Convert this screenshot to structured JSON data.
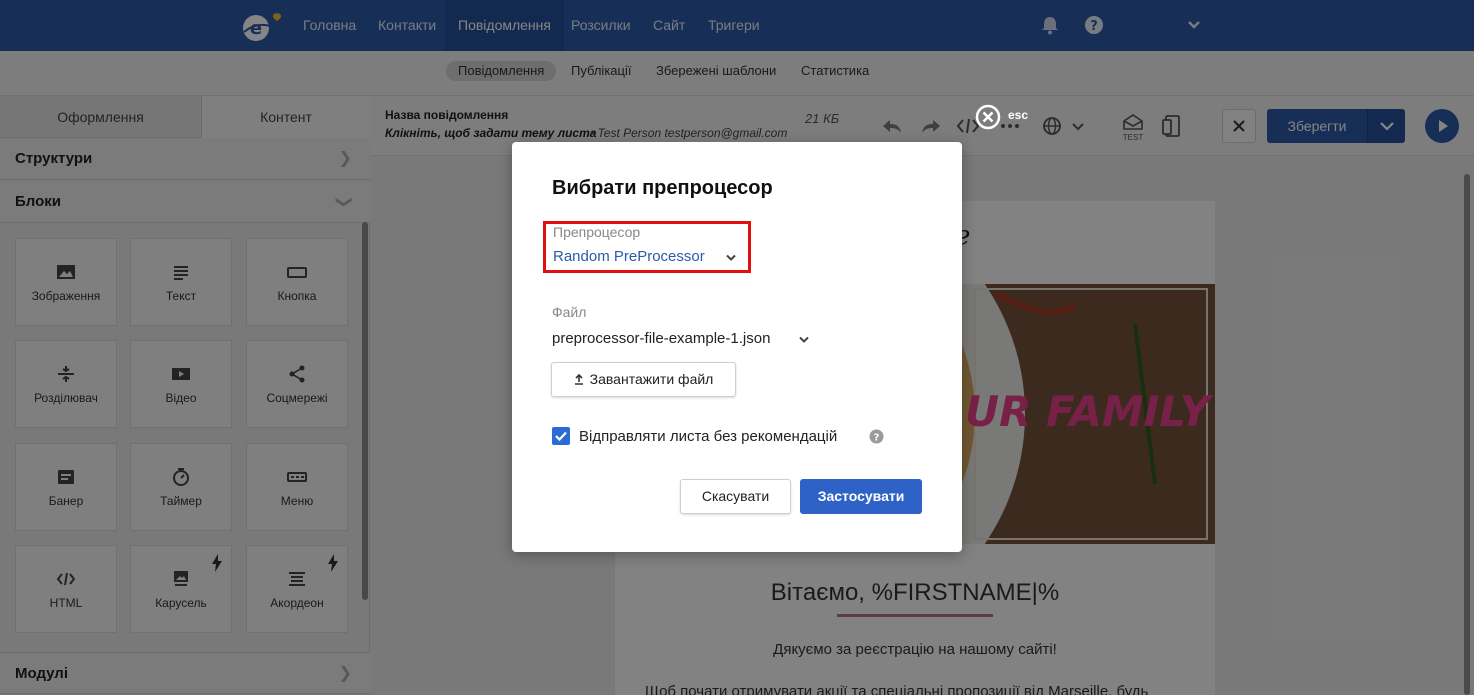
{
  "topnav": {
    "items": [
      "Головна",
      "Контакти",
      "Повідомлення",
      "Розсилки",
      "Сайт",
      "Тригери"
    ],
    "active_index": 2,
    "icons": [
      "bell-icon",
      "help-icon",
      "chevron-down-icon"
    ]
  },
  "subnav": {
    "items": [
      "Повідомлення",
      "Публікації",
      "Збережені шаблони",
      "Статистика"
    ],
    "active_index": 0
  },
  "leftpanel": {
    "tabs": [
      "Оформлення",
      "Контент"
    ],
    "active_tab": 1,
    "sections": {
      "structures": "Структури",
      "blocks": "Блоки",
      "modules": "Модулі"
    },
    "blocks": [
      {
        "label": "Зображення",
        "icon": "image-icon"
      },
      {
        "label": "Текст",
        "icon": "text-icon"
      },
      {
        "label": "Кнопка",
        "icon": "button-icon"
      },
      {
        "label": "Розділювач",
        "icon": "divider-icon"
      },
      {
        "label": "Відео",
        "icon": "video-icon"
      },
      {
        "label": "Соцмережі",
        "icon": "share-icon"
      },
      {
        "label": "Банер",
        "icon": "banner-icon"
      },
      {
        "label": "Таймер",
        "icon": "timer-icon"
      },
      {
        "label": "Меню",
        "icon": "menu-icon"
      },
      {
        "label": "HTML",
        "icon": "code-icon"
      },
      {
        "label": "Карусель",
        "icon": "carousel-icon",
        "premium": true
      },
      {
        "label": "Акордеон",
        "icon": "accordion-icon",
        "premium": true
      }
    ]
  },
  "editor": {
    "message_title": "Назва повідомлення",
    "subject_placeholder": "Клікніть, щоб задати тему листа",
    "sender": "• Test Person testperson@gmail.com",
    "size": "21 КБ",
    "save_label": "Зберегти",
    "test_label": "TEST"
  },
  "email": {
    "greeting": "Вітаємо, %FIRSTNAME|%",
    "thanks": "Дякуємо за реєстрацію на нашому сайті!",
    "cut_text": "Щоб почати отримувати акції та спеціальні пропозиції від Marseille, будь",
    "banner_partial": "UR FAMILY",
    "header_fragment": "e"
  },
  "modal": {
    "esc_label": "esc",
    "title": "Вибрати препроцесор",
    "preprocessor_label": "Препроцесор",
    "preprocessor_value": "Random PreProcessor",
    "file_label": "Файл",
    "file_value": "preprocessor-file-example-1.json",
    "upload_label": "Завантажити файл",
    "checkbox_label": "Відправляти листа без рекомендацій",
    "checkbox_checked": true,
    "cancel_label": "Скасувати",
    "apply_label": "Застосувати"
  },
  "colors": {
    "brand_blue": "#2c5aa8",
    "apply_blue": "#2e62c7",
    "highlight_red": "#e01010",
    "link_blue": "#2c5aa8"
  }
}
